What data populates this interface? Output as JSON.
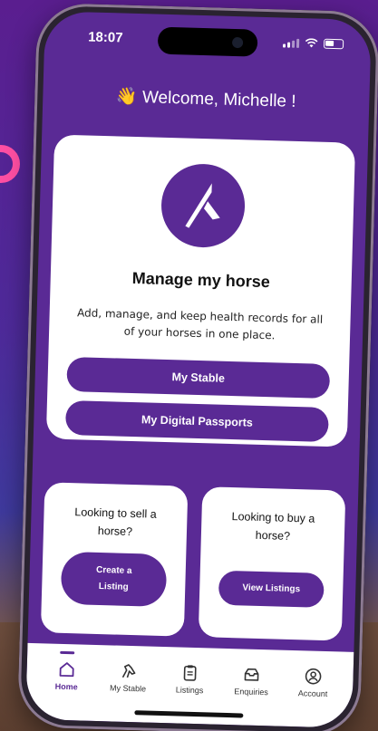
{
  "status": {
    "time": "18:07"
  },
  "welcome": {
    "emoji": "👋",
    "text": "Welcome, Michelle !"
  },
  "manage_card": {
    "title": "Manage my horse",
    "description": "Add, manage, and keep health records for all of your horses in one place.",
    "buttons": [
      "My Stable",
      "My Digital Passports"
    ]
  },
  "sell_card": {
    "text": "Looking to sell a horse?",
    "button": "Create a Listing"
  },
  "buy_card": {
    "text": "Looking to buy a horse?",
    "button": "View Listings"
  },
  "tabs": [
    {
      "label": "Home",
      "icon": "home-icon",
      "active": true
    },
    {
      "label": "My Stable",
      "icon": "horse-icon",
      "active": false
    },
    {
      "label": "Listings",
      "icon": "clipboard-icon",
      "active": false
    },
    {
      "label": "Enquiries",
      "icon": "inbox-icon",
      "active": false
    },
    {
      "label": "Account",
      "icon": "account-icon",
      "active": false
    }
  ],
  "colors": {
    "brand": "#5a2a95",
    "accent_ring": "#ff4fa3"
  }
}
